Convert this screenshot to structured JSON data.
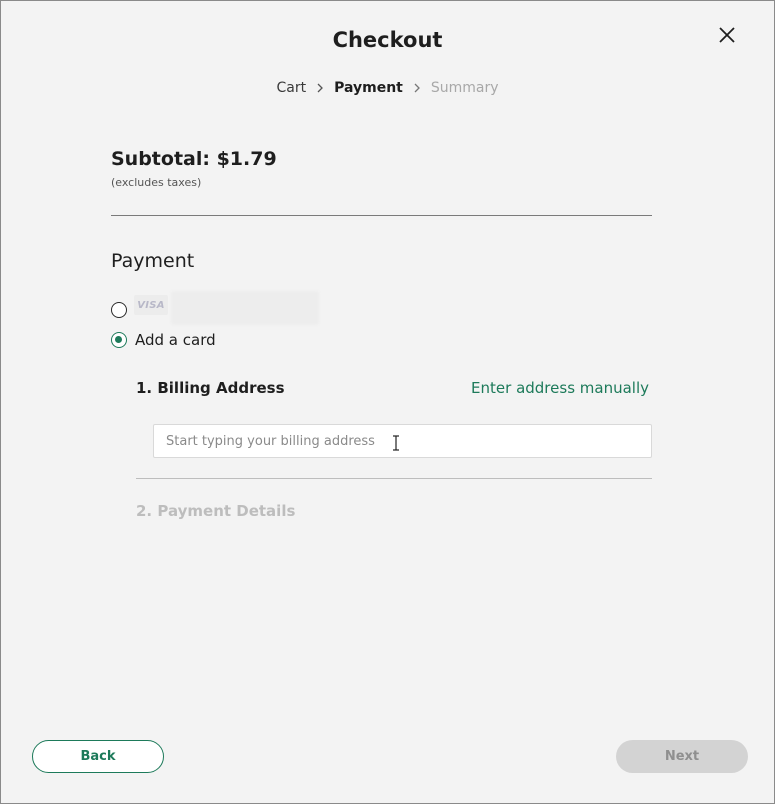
{
  "header": {
    "title": "Checkout",
    "close_icon": "close-icon"
  },
  "breadcrumb": {
    "items": [
      {
        "label": "Cart",
        "state": "done"
      },
      {
        "label": "Payment",
        "state": "active"
      },
      {
        "label": "Summary",
        "state": "disabled"
      }
    ]
  },
  "summary": {
    "subtotal": "Subtotal: $1.79",
    "note": "(excludes taxes)"
  },
  "payment": {
    "heading": "Payment",
    "saved_card": {
      "brand": "VISA",
      "selected": false
    },
    "add_card": {
      "label": "Add a card",
      "selected": true
    }
  },
  "billing": {
    "title": "1. Billing Address",
    "manual_link": "Enter address manually",
    "input_placeholder": "Start typing your billing address",
    "input_value": ""
  },
  "payment_details": {
    "title": "2. Payment Details"
  },
  "footer": {
    "back_label": "Back",
    "next_label": "Next"
  },
  "colors": {
    "accent": "#1d7a5a",
    "background": "#f3f3f3",
    "disabled": "#d3d3d3"
  }
}
